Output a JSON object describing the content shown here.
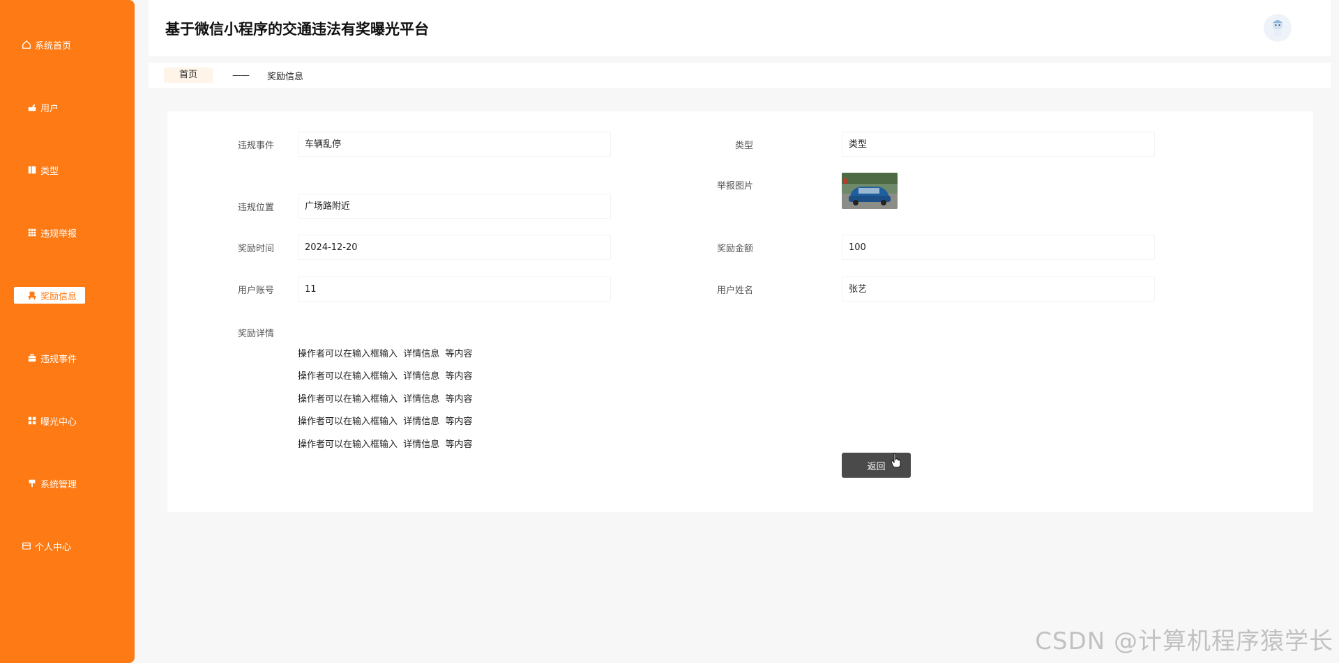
{
  "app": {
    "title": "基于微信小程序的交通违法有奖曝光平台"
  },
  "sidebar": {
    "items": [
      {
        "label": "系统首页",
        "icon": "home-icon"
      },
      {
        "label": "用户",
        "icon": "user-icon"
      },
      {
        "label": "类型",
        "icon": "book-icon"
      },
      {
        "label": "违规举报",
        "icon": "grid-icon"
      },
      {
        "label": "奖励信息",
        "icon": "chair-icon",
        "active": true
      },
      {
        "label": "违规事件",
        "icon": "briefcase-icon"
      },
      {
        "label": "曝光中心",
        "icon": "dashboard-icon"
      },
      {
        "label": "系统管理",
        "icon": "pin-icon"
      },
      {
        "label": "个人中心",
        "icon": "card-icon"
      }
    ]
  },
  "breadcrumb": {
    "home": "首页",
    "separator": "——",
    "current": "奖励信息"
  },
  "form": {
    "violation_event": {
      "label": "违规事件",
      "value": "车辆乱停"
    },
    "type": {
      "label": "类型",
      "value": "类型"
    },
    "report_image": {
      "label": "举报图片",
      "alt": "car-photo"
    },
    "violation_location": {
      "label": "违规位置",
      "value": "广场路附近"
    },
    "reward_time": {
      "label": "奖励时间",
      "value": "2024-12-20"
    },
    "reward_amount": {
      "label": "奖励金额",
      "value": "100"
    },
    "user_account": {
      "label": "用户账号",
      "value": "11"
    },
    "user_name": {
      "label": "用户姓名",
      "value": "张艺"
    },
    "reward_detail": {
      "label": "奖励详情",
      "lines": [
        "操作者可以在输入框输入  详情信息  等内容",
        "操作者可以在输入框输入  详情信息  等内容",
        "操作者可以在输入框输入  详情信息  等内容",
        "操作者可以在输入框输入  详情信息  等内容",
        "操作者可以在输入框输入  详情信息  等内容"
      ]
    },
    "back_button": "返回"
  },
  "watermark": "CSDN @计算机程序猿学长",
  "colors": {
    "sidebar": "#fe7a14",
    "button": "#4a4a4a"
  }
}
